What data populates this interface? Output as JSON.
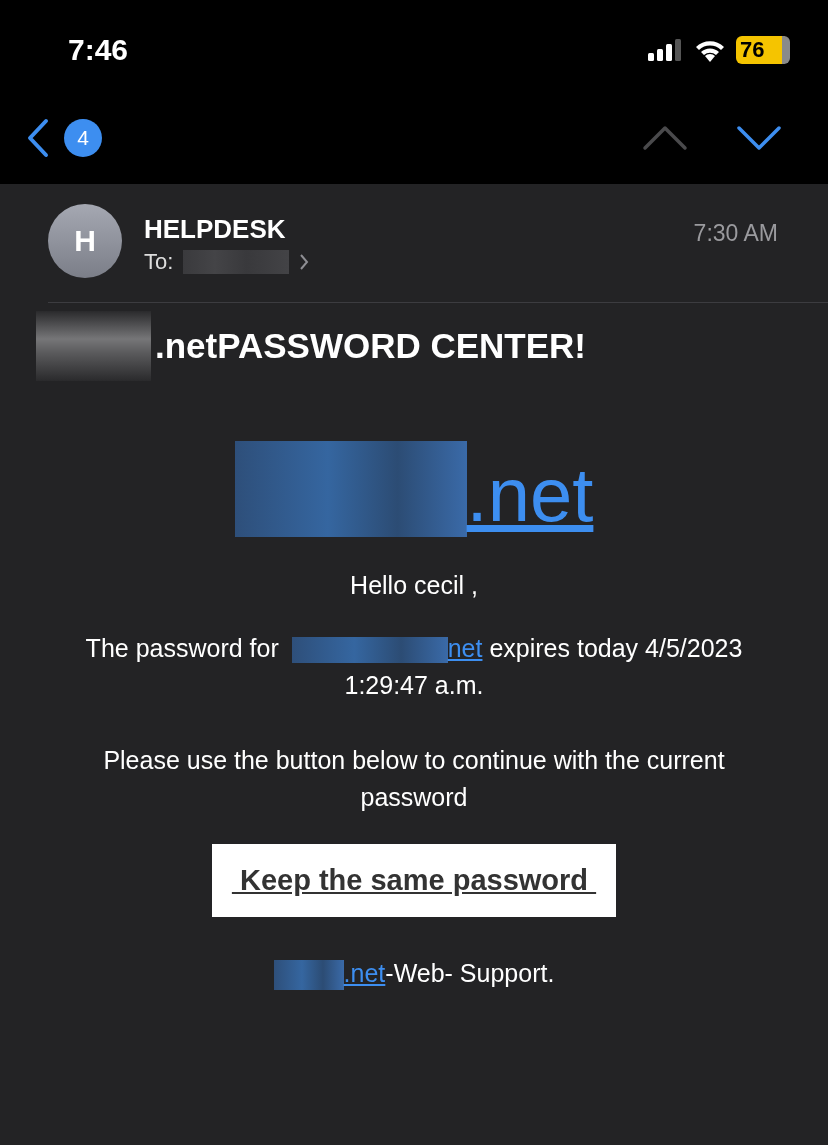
{
  "status_bar": {
    "time": "7:46",
    "battery": "76"
  },
  "nav": {
    "unread_count": "4",
    "previous_enabled": false,
    "next_enabled": true
  },
  "message": {
    "sender_initial": "H",
    "sender": "HELPDESK",
    "to_label": "To:",
    "time": "7:30 AM"
  },
  "body": {
    "heading": ".netPASSWORD CENTER!",
    "logo_link": ".net",
    "greeting": "Hello cecil ,",
    "expiry": {
      "before": "The password for ",
      "link": "net",
      "after": " expires today 4/5/2023 1:29:47 a.m."
    },
    "instruction": "Please use the button below to continue with the current password",
    "button": " Keep the same password ",
    "signature": {
      "link": ".net",
      "after": "-Web- Support."
    }
  }
}
